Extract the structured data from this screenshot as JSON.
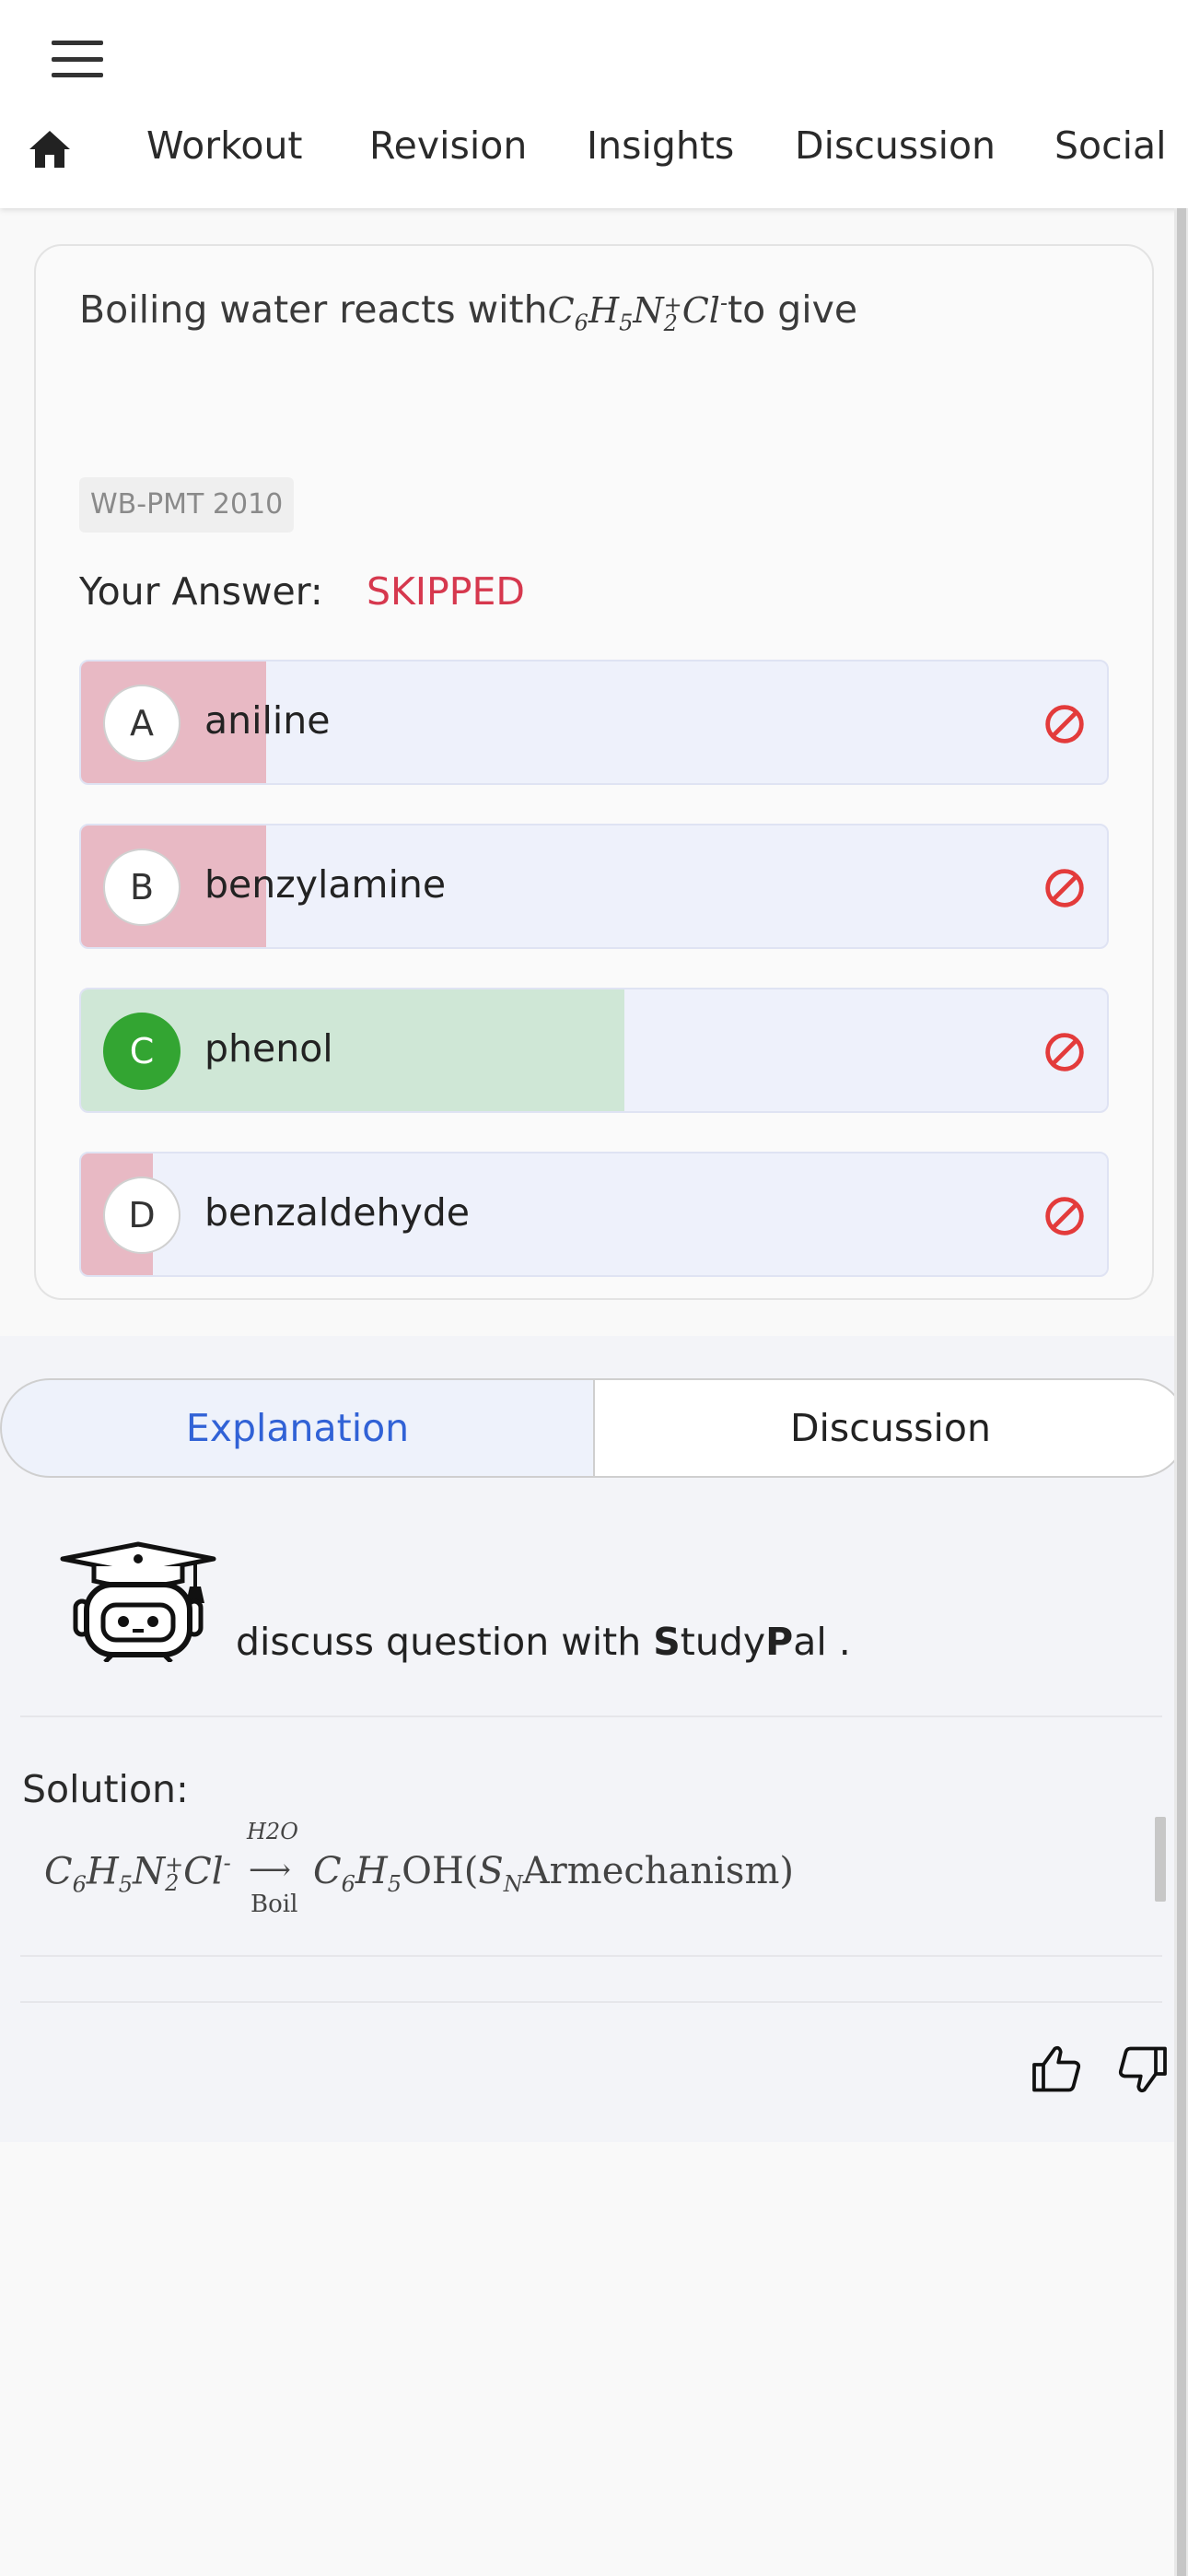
{
  "nav": {
    "items": [
      "Workout",
      "Revision",
      "Insights",
      "Discussion",
      "Social"
    ]
  },
  "question": {
    "text_prefix": "Boiling water reacts with",
    "formula": {
      "c": "C",
      "c_sub": "6",
      "h": "H",
      "h_sub": "5",
      "n": "N",
      "n_sub": "2",
      "n_sup": "+",
      "cl": "Cl",
      "cl_sup": "-"
    },
    "text_suffix": "to give",
    "tag": "WB-PMT 2010",
    "your_answer_label": "Your Answer:",
    "your_answer_value": "SKIPPED",
    "options": [
      {
        "letter": "A",
        "label": "aniline",
        "percent": 18,
        "correct": false
      },
      {
        "letter": "B",
        "label": "benzylamine",
        "percent": 18,
        "correct": false
      },
      {
        "letter": "C",
        "label": "phenol",
        "percent": 53,
        "correct": true
      },
      {
        "letter": "D",
        "label": "benzaldehyde",
        "percent": 7,
        "correct": false
      }
    ]
  },
  "tabs": {
    "explanation": "Explanation",
    "discussion": "Discussion"
  },
  "studypal": {
    "text_before": "discuss question with ",
    "s": "S",
    "tudy": "tudy",
    "p": "P",
    "al": "al ."
  },
  "solution": {
    "label": "Solution:",
    "reagent_top": "H2O",
    "reagent_bottom": "Boil",
    "product_tail": "OH(",
    "mechanism": "Armechanism)"
  },
  "colors": {
    "accent": "#3162d6",
    "skipped": "#d6384e",
    "correct": "#33a532",
    "wrong_fill": "#e8b9c4",
    "correct_fill": "#cfe7d6"
  }
}
